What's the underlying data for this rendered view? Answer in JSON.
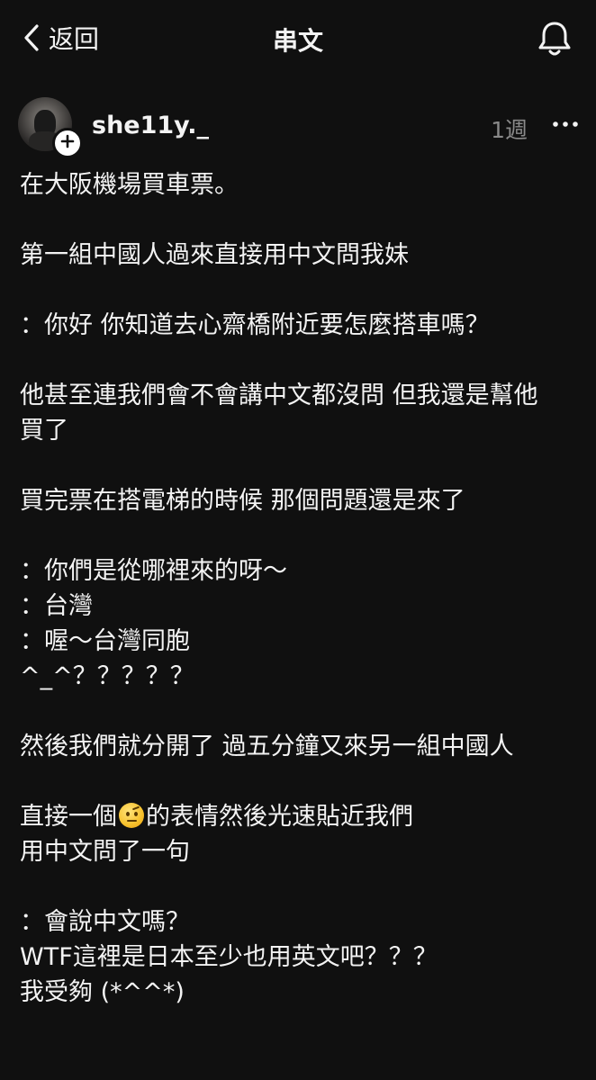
{
  "nav": {
    "back_label": "返回",
    "title": "串文",
    "back_icon": "chevron-left-icon",
    "notification_icon": "bell-icon"
  },
  "post": {
    "username": "she11y._",
    "timestamp": "1週",
    "more_icon": "more-horizontal-icon",
    "follow_icon": "plus-icon",
    "emoji": "raised-eyebrow-emoji",
    "lines": [
      "在大阪機場買車票。",
      "",
      "第一組中國人過來直接用中文問我妹",
      "",
      "：你好 你知道去心齋橋附近要怎麼搭車嗎？",
      "",
      "他甚至連我們會不會講中文都沒問 但我還是幫他",
      "買了",
      "",
      "買完票在搭電梯的時候 那個問題還是來了",
      "",
      "：你們是從哪裡來的呀～",
      "：台灣",
      "：喔～台灣同胞",
      "^_^？？？？？",
      "",
      "然後我們就分開了 過五分鐘又來另一組中國人",
      "",
      "直接一個",
      "用中文問了一句",
      "",
      "：會說中文嗎？",
      "WTF這裡是日本至少也用英文吧？？？",
      "我受夠 (*^^*)"
    ],
    "emoji_line_suffix": "的表情然後光速貼近我們"
  },
  "colors": {
    "background": "#101010",
    "text": "#f3f3f3",
    "muted": "#8a8a8a"
  }
}
